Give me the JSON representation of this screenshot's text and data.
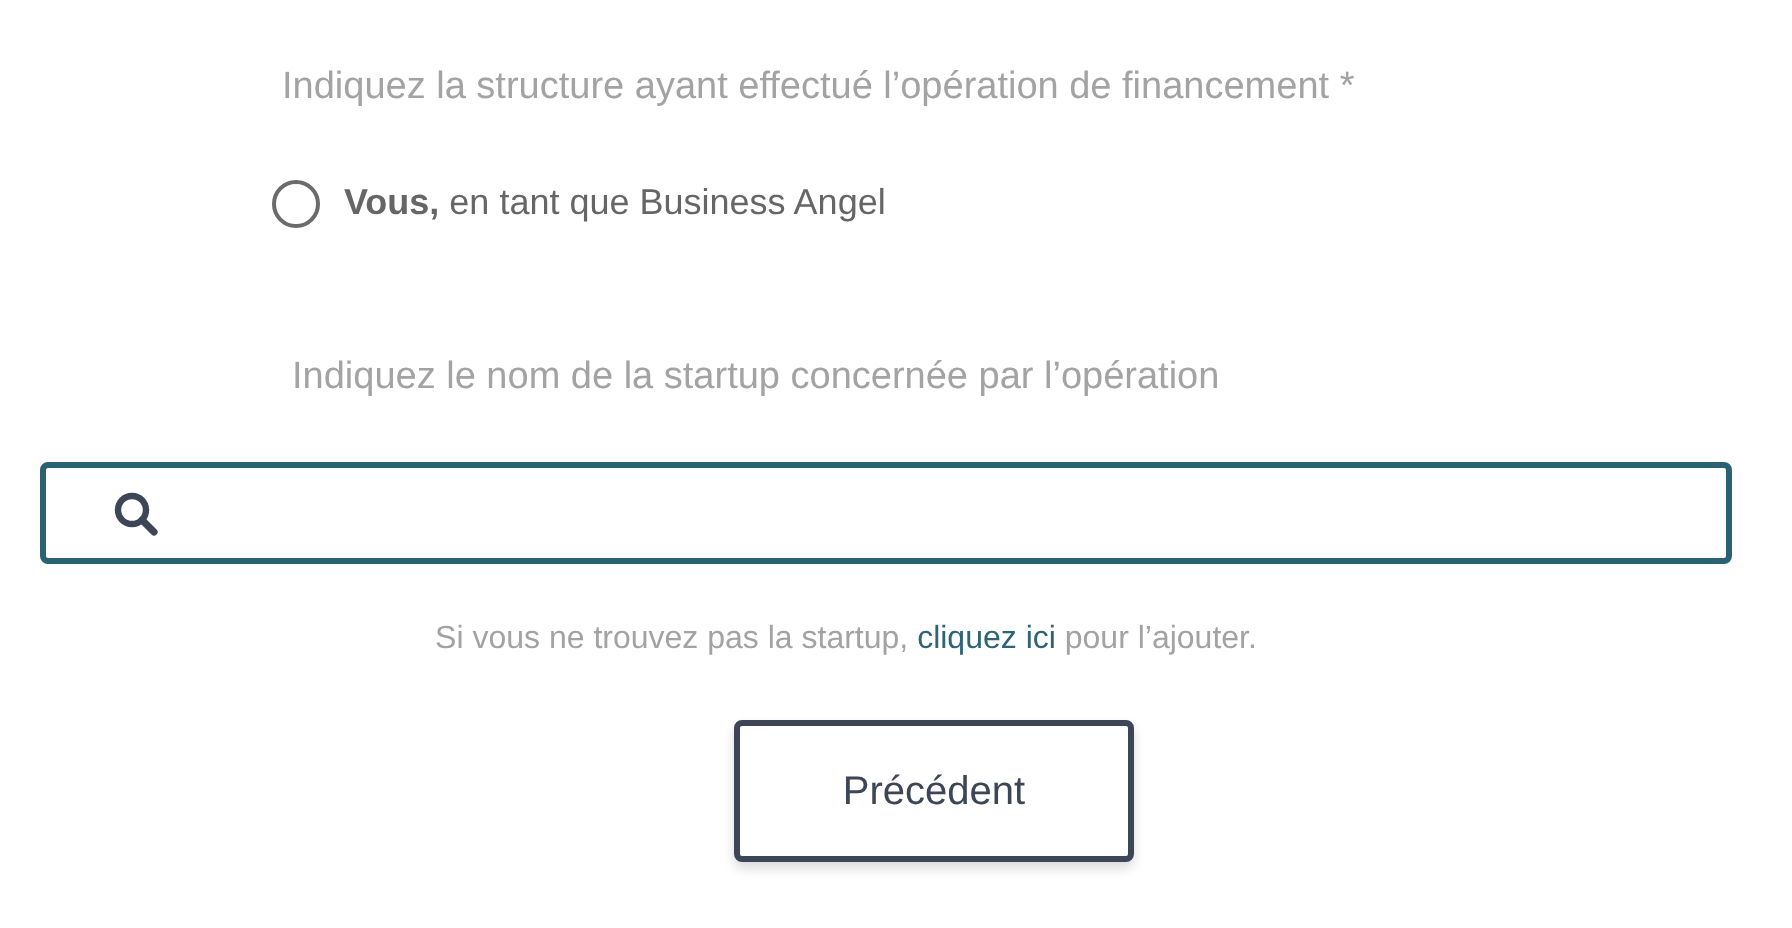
{
  "structure_question": {
    "label": "Indiquez la structure ayant effectué l’opération de financement *"
  },
  "structure_options": [
    {
      "label": "**Vous,** en tant que Business Angel",
      "selected": false
    }
  ],
  "startup_question": {
    "label": "Indiquez le nom de la startup concernée par l’opération"
  },
  "hint": {
    "before": "Si vous ne trouvez pas la startup, ",
    "link": "cliquez ici",
    "after": " pour l’ajouter."
  },
  "buttons": [
    {
      "label": "Précédent"
    }
  ]
}
